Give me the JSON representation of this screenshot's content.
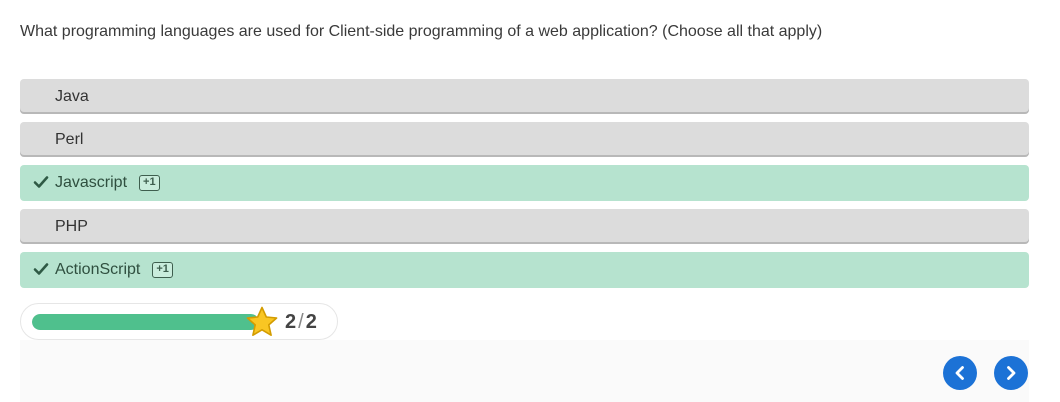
{
  "question": {
    "text": "What programming languages are used for Client-side programming of a web application? (Choose all that apply)"
  },
  "options": [
    {
      "label": "Java",
      "correct": false
    },
    {
      "label": "Perl",
      "correct": false
    },
    {
      "label": "Javascript",
      "correct": true,
      "badge": "+1"
    },
    {
      "label": "PHP",
      "correct": false
    },
    {
      "label": "ActionScript",
      "correct": true,
      "badge": "+1"
    }
  ],
  "progress": {
    "fraction": 1.0,
    "score": "2",
    "total": "2",
    "separator": "/",
    "icon": "star-icon"
  },
  "navigation": {
    "previous_icon": "chevron-left-icon",
    "next_icon": "chevron-right-icon"
  },
  "colors": {
    "correct_background": "#b6e3cf",
    "neutral_background": "#dcdcdc",
    "progress_fill": "#4fc08d",
    "nav_button": "#1c72d6",
    "star": "#f9c623"
  }
}
